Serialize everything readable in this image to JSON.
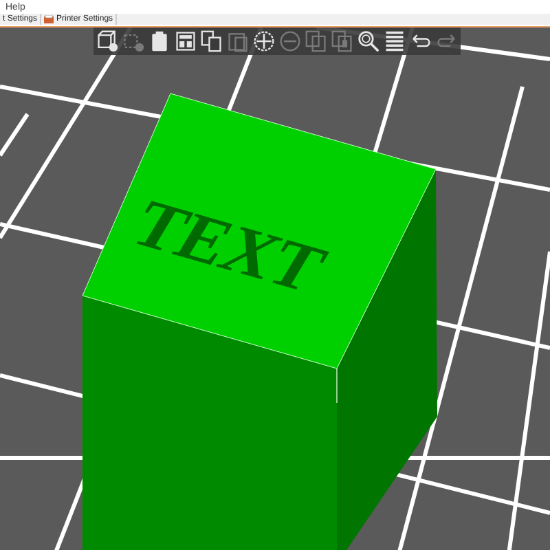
{
  "menu": [
    "Help"
  ],
  "tabs": [
    {
      "label": "t Settings",
      "selected": false
    },
    {
      "label": "Printer Settings",
      "selected": false
    }
  ],
  "toolbar": [
    {
      "kind": "add",
      "disabled": false
    },
    {
      "kind": "delete",
      "disabled": true
    },
    {
      "kind": "clipboard",
      "disabled": false
    },
    {
      "kind": "arrange",
      "disabled": false
    },
    {
      "kind": "copy",
      "disabled": false
    },
    {
      "kind": "paste",
      "disabled": true
    },
    {
      "kind": "plus",
      "disabled": false
    },
    {
      "kind": "minus",
      "disabled": true
    },
    {
      "kind": "split-o",
      "disabled": true
    },
    {
      "kind": "split-p",
      "disabled": true
    },
    {
      "kind": "search",
      "disabled": false
    },
    {
      "kind": "layers",
      "disabled": false
    },
    {
      "kind": "undo",
      "disabled": false
    },
    {
      "kind": "redo",
      "disabled": true
    }
  ],
  "model_label": "TEXT"
}
